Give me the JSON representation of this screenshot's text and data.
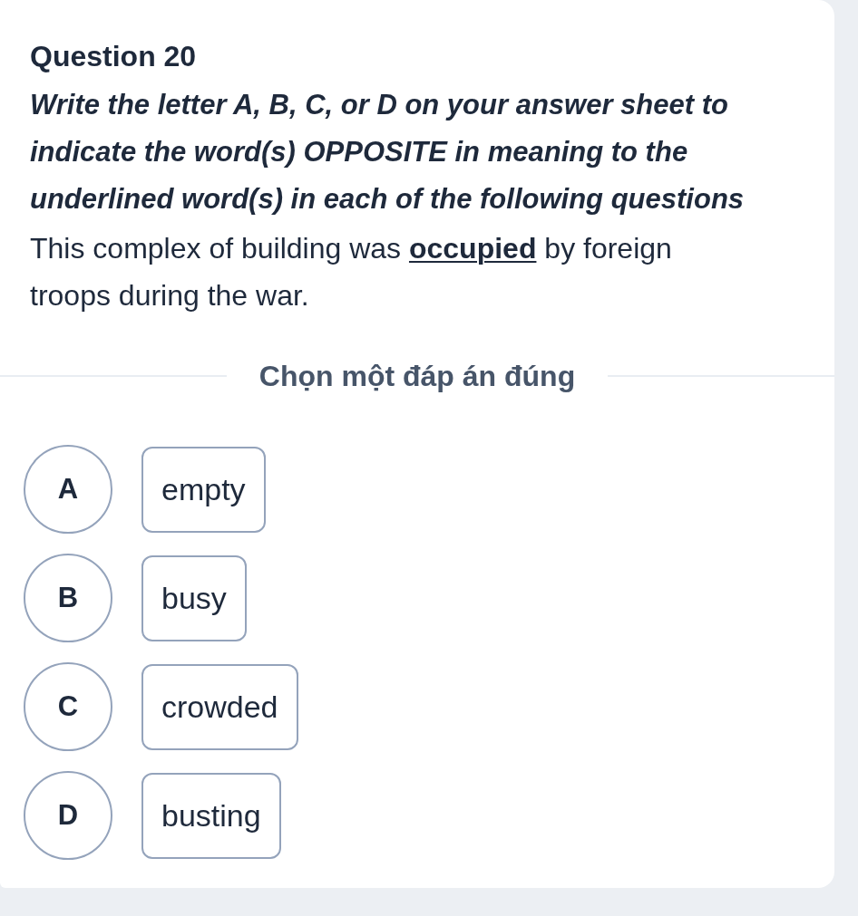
{
  "question": {
    "title": "Question 20",
    "instruction": "Write the letter A, B, C, or D on your answer sheet to indicate the word(s) OPPOSITE in meaning to the underlined word(s) in each of the following questions",
    "sentence": "This complex of building was **occupied** by foreign troops during the war."
  },
  "prompt": "Chọn một đáp án đúng",
  "options": [
    {
      "letter": "A",
      "text": "empty",
      "selected": false
    },
    {
      "letter": "B",
      "text": "busy",
      "selected": false
    },
    {
      "letter": "C",
      "text": "crowded",
      "selected": false
    },
    {
      "letter": "D",
      "text": "busting",
      "selected": false
    }
  ]
}
